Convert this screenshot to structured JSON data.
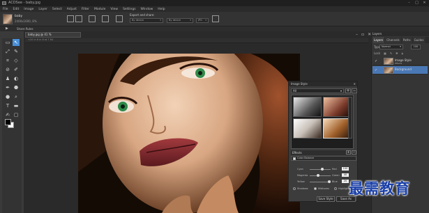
{
  "window": {
    "title": "ACDSee - baby.jpg"
  },
  "menu": [
    "File",
    "Edit",
    "Image",
    "Layer",
    "Select",
    "Adjust",
    "Filter",
    "Module",
    "View",
    "Settings",
    "Window",
    "Help"
  ],
  "options": {
    "doc_name": "baby",
    "doc_size": "2400x1600, 8%",
    "export_label": "Export and share:",
    "dropdowns": [
      "By device",
      "By device",
      "JPG"
    ]
  },
  "share": {
    "label": "Share Rules"
  },
  "document": {
    "tab_label": "baby.jpg @ 41 %",
    "ruler_text": "<10   in 6 in 8 at 7 84"
  },
  "image_style": {
    "title": "Image Style",
    "preset": "All",
    "effects_label": "Effects",
    "effect_item": "Color Balance",
    "sliders": [
      {
        "label": "Cyan",
        "right": "Red",
        "value": "100"
      },
      {
        "label": "Magenta",
        "right": "Green",
        "value": "40"
      },
      {
        "label": "Yellow",
        "right": "Blue",
        "value": "20"
      }
    ],
    "radios": [
      "Shadows",
      "Midtones",
      "Highlights"
    ],
    "footer": [
      "Save Style",
      "Save As"
    ]
  },
  "layers_panel": {
    "header": "Layers",
    "tabs": [
      "Layers",
      "Channels",
      "Paths",
      "Guides"
    ],
    "blend_label": "Type",
    "blend_value": "Normal",
    "opacity": "100",
    "lock_label": "Lock",
    "layers": [
      {
        "name": "Image Style",
        "sub": "Effects",
        "selected": false
      },
      {
        "name": "Background",
        "sub": "",
        "selected": true
      }
    ]
  },
  "watermark": "最需教育",
  "colors": {
    "accent": "#4a90d9",
    "selection": "#4a78b5",
    "watermark": "#1a3fa8"
  }
}
